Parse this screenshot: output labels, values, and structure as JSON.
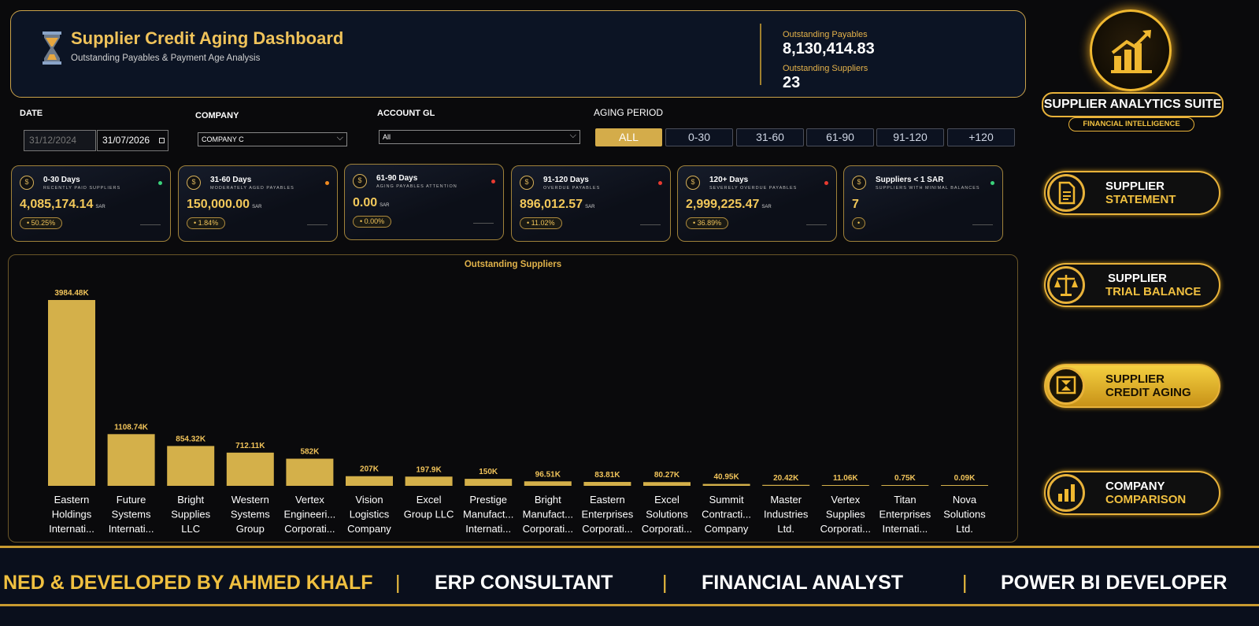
{
  "header": {
    "title": "Supplier Credit Aging Dashboard",
    "subtitle": "Outstanding Payables & Payment Age Analysis",
    "kpi1_label": "Outstanding Payables",
    "kpi1_value": "8,130,414.83",
    "kpi2_label": "Outstanding Suppliers",
    "kpi2_value": "23"
  },
  "filters": {
    "date_label": "DATE",
    "date_from": "31/12/2024",
    "date_to": "31/07/2026",
    "company_label": "COMPANY",
    "company_value": "COMPANY C",
    "account_label": "ACCOUNT GL",
    "account_value": "All",
    "aging_label": "AGING PERIOD",
    "aging_options": [
      "ALL",
      "0-30",
      "31-60",
      "61-90",
      "91-120",
      "+120"
    ]
  },
  "cards": [
    {
      "title": "0-30 Days",
      "subtitle": "RECENTLY PAID SUPPLIERS",
      "value": "4,085,174.14",
      "unit": "SAR",
      "pct": "50.25%",
      "dot": "#3ad27a"
    },
    {
      "title": "31-60 Days",
      "subtitle": "MODERATELY AGED PAYABLES",
      "value": "150,000.00",
      "unit": "SAR",
      "pct": "1.84%",
      "dot": "#f08a20"
    },
    {
      "title": "61-90 Days",
      "subtitle": "AGING PAYABLES ATTENTION",
      "value": "0.00",
      "unit": "SAR",
      "pct": "0.00%",
      "dot": "#e83a30"
    },
    {
      "title": "91-120 Days",
      "subtitle": "OVERDUE PAYABLES",
      "value": "896,012.57",
      "unit": "SAR",
      "pct": "11.02%",
      "dot": "#e83a30"
    },
    {
      "title": "120+ Days",
      "subtitle": "SEVERELY OVERDUE PAYABLES",
      "value": "2,999,225.47",
      "unit": "SAR",
      "pct": "36.89%",
      "dot": "#e83a30"
    },
    {
      "title": "Suppliers < 1 SAR",
      "subtitle": "SUPPLIERS WITH MINIMAL BALANCES",
      "value": "7",
      "unit": "",
      "pct": "",
      "dot": "#3ad27a"
    }
  ],
  "chart_data": {
    "type": "bar",
    "title": "Outstanding Suppliers",
    "categories": [
      [
        "Eastern",
        "Holdings",
        "Internati..."
      ],
      [
        "Future",
        "Systems",
        "Internati..."
      ],
      [
        "Bright",
        "Supplies",
        "LLC"
      ],
      [
        "Western",
        "Systems",
        "Group"
      ],
      [
        "Vertex",
        "Engineeri...",
        "Corporati..."
      ],
      [
        "Vision",
        "Logistics",
        "Company"
      ],
      [
        "Excel",
        "Group LLC"
      ],
      [
        "Prestige",
        "Manufact...",
        "Internati..."
      ],
      [
        "Bright",
        "Manufact...",
        "Corporati..."
      ],
      [
        "Eastern",
        "Enterprises",
        "Corporati..."
      ],
      [
        "Excel",
        "Solutions",
        "Corporati..."
      ],
      [
        "Summit",
        "Contracti...",
        "Company"
      ],
      [
        "Master",
        "Industries",
        "Ltd."
      ],
      [
        "Vertex",
        "Supplies",
        "Corporati..."
      ],
      [
        "Titan",
        "Enterprises",
        "Internati..."
      ],
      [
        "Nova",
        "Solutions",
        "Ltd."
      ]
    ],
    "values": [
      3984.48,
      1108.74,
      854.32,
      712.11,
      582,
      207,
      197.9,
      150,
      96.51,
      83.81,
      80.27,
      40.95,
      20.42,
      11.06,
      0.75,
      0.09
    ],
    "labels": [
      "3984.48K",
      "1108.74K",
      "854.32K",
      "712.11K",
      "582K",
      "207K",
      "197.9K",
      "150K",
      "96.51K",
      "83.81K",
      "80.27K",
      "40.95K",
      "20.42K",
      "11.06K",
      "0.75K",
      "0.09K"
    ],
    "bar_color": "#d4b04a",
    "grid": false
  },
  "sidebar": {
    "suite_title": "SUPPLIER ANALYTICS SUITE",
    "suite_subtitle": "FINANCIAL INTELLIGENCE",
    "nav": [
      {
        "l1": "SUPPLIER",
        "l2": "STATEMENT",
        "icon": "document-icon",
        "active": false
      },
      {
        "l1": "SUPPLIER",
        "l2": "TRIAL BALANCE",
        "icon": "scale-icon",
        "active": false
      },
      {
        "l1": "SUPPLIER",
        "l2": "CREDIT AGING",
        "icon": "hourglass-icon",
        "active": true
      },
      {
        "l1": "COMPANY",
        "l2": "COMPARISON",
        "icon": "bar-chart-icon",
        "active": false
      }
    ]
  },
  "footer": {
    "credit": "NED & DEVELOPED BY AHMED KHALF",
    "role1": "ERP CONSULTANT",
    "role2": "FINANCIAL ANALYST",
    "role3": "POWER BI DEVELOPER",
    "sep": "|"
  },
  "colors": {
    "gold": "#f0c35a",
    "navy": "#0c1424",
    "bg": "#0a0a0c"
  }
}
